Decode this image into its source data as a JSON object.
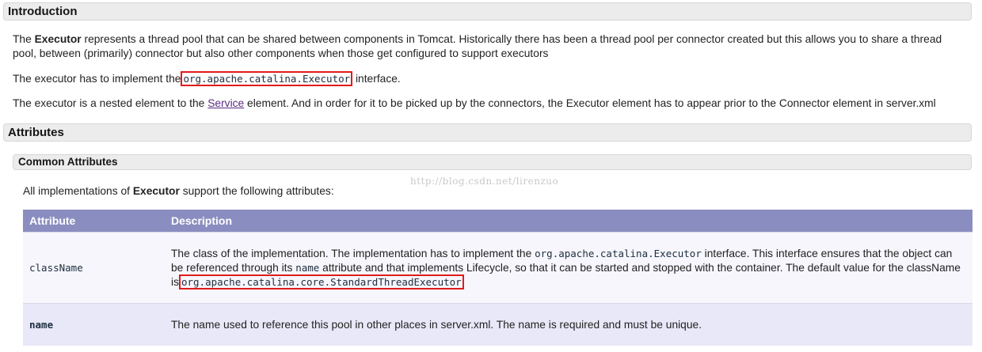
{
  "sections": {
    "introduction": "Introduction",
    "attributes": "Attributes",
    "common_attributes": "Common Attributes"
  },
  "intro": {
    "p1_pre": "The ",
    "p1_bold": "Executor",
    "p1_post": " represents a thread pool that can be shared between components in Tomcat. Historically there has been a thread pool per connector created but this allows you to share a thread pool, between (primarily) connector but also other components when those get configured to support executors",
    "p2_pre": "The executor has to implement the",
    "p2_code": "org.apache.catalina.Executor",
    "p2_post": " interface.",
    "p3_pre": "The executor is a nested element to the ",
    "p3_link": "Service",
    "p3_post": " element. And in order for it to be picked up by the connectors, the Executor element has to appear prior to the Connector element in server.xml"
  },
  "attrs_intro": {
    "pre": "All implementations of ",
    "bold": "Executor",
    "post": " support the following attributes:"
  },
  "watermark": "http://blog.csdn.net/lirenzuo",
  "table": {
    "headers": [
      "Attribute",
      "Description"
    ],
    "rows": [
      {
        "name": "className",
        "desc_1": "The class of the implementation. The implementation has to implement the ",
        "code_1": "org.apache.catalina.Executor",
        "desc_2": " interface. This interface ensures that the object can be referenced through its ",
        "code_2": "name",
        "desc_3": " attribute and that implements Lifecycle, so that it can be started and stopped with the container. The default value for the className is",
        "code_3": "org.apache.catalina.core.StandardThreadExecutor"
      },
      {
        "name": "name",
        "desc": "The name used to reference this pool in other places in server.xml. The name is required and must be unique."
      }
    ]
  },
  "colors": {
    "highlight_box": "#e01b1b",
    "table_header": "#8a8dbf",
    "link": "#5a2a82"
  }
}
